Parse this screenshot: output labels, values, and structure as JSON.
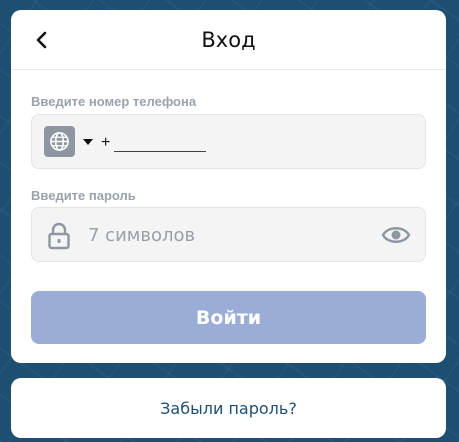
{
  "header": {
    "title": "Вход",
    "back_icon": "chevron-left-icon"
  },
  "phone": {
    "label": "Введите номер телефона",
    "prefix": "+",
    "value": "",
    "country_icon": "globe-icon"
  },
  "password": {
    "label": "Введите пароль",
    "placeholder": "7 символов",
    "lock_icon": "lock-icon",
    "toggle_icon": "eye-icon"
  },
  "login_button": {
    "label": "Войти"
  },
  "forgot": {
    "label": "Забыли пароль?"
  },
  "colors": {
    "background": "#1d4f73",
    "button": "#9aadd6",
    "link": "#1f4f75",
    "label": "#9aa3ad",
    "field_bg": "#f4f4f5"
  }
}
